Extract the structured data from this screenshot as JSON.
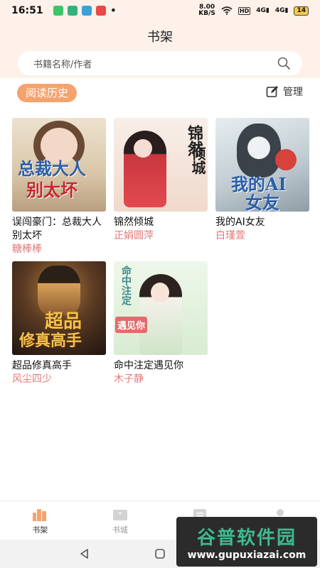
{
  "status_bar": {
    "time": "16:51",
    "net_speed_value": "8.00",
    "net_speed_unit": "KB/S",
    "hd_label": "HD",
    "signal1": "4G",
    "signal2": "4G",
    "battery": "14"
  },
  "header": {
    "title": "书架"
  },
  "search": {
    "placeholder": "书籍名称/作者"
  },
  "toolbar": {
    "history_label": "阅读历史",
    "manage_label": "管理"
  },
  "books": [
    {
      "title": "误闯豪门：总裁大人别太坏",
      "author": "糖棒棒",
      "cover_lines": [
        "总裁大人",
        "别太坏"
      ],
      "cover_colors": [
        "#e9ddc6",
        "#c9b79a"
      ]
    },
    {
      "title": "锦然倾城",
      "author": "正娟圆萍",
      "cover_lines": [
        "锦然",
        "倾城"
      ],
      "cover_colors": [
        "#f6ebe4",
        "#e9c7b7"
      ]
    },
    {
      "title": "我的AI女友",
      "author": "白瑾萱",
      "cover_lines": [
        "我的AI",
        "女友"
      ],
      "cover_colors": [
        "#d9e2e6",
        "#aebbc2"
      ]
    },
    {
      "title": "超品修真高手",
      "author": "风尘四少",
      "cover_lines": [
        "超品",
        "修真高手"
      ],
      "cover_colors": [
        "#5a3a23",
        "#2a1d14"
      ]
    },
    {
      "title": "命中注定遇见你",
      "author": "木子静",
      "cover_lines": [
        "命中注定",
        "遇见你"
      ],
      "cover_colors": [
        "#e8f3e4",
        "#bfdcb8"
      ]
    }
  ],
  "bottom_nav": [
    {
      "label": "书架",
      "icon": "bookshelf-icon",
      "active": true
    },
    {
      "label": "书城",
      "icon": "bookstore-icon",
      "active": false
    },
    {
      "label": "",
      "icon": "list-icon",
      "active": false
    },
    {
      "label": "",
      "icon": "profile-icon",
      "active": false
    }
  ],
  "watermark": {
    "main": "谷普软件园",
    "sub": "www.gupuxiazai.com"
  },
  "colors": {
    "accent": "#f5a36e",
    "author": "#e07a7a",
    "header_bg": "#fdf1e9"
  }
}
